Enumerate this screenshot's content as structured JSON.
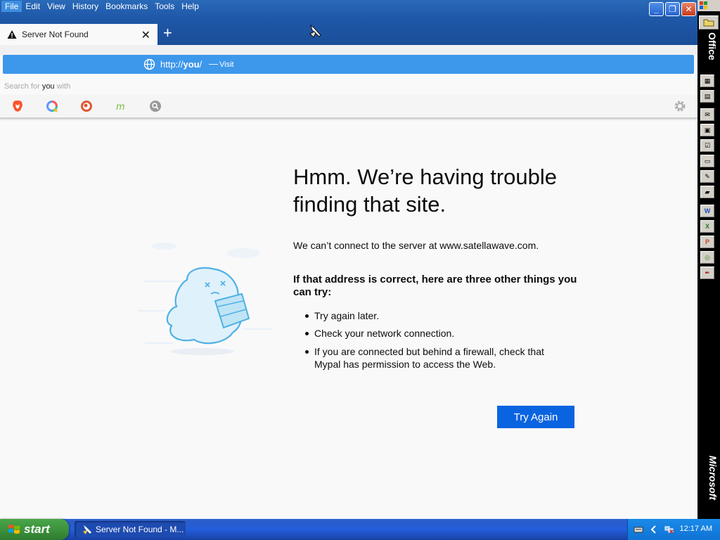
{
  "menubar": {
    "items": [
      "File",
      "Edit",
      "View",
      "History",
      "Bookmarks",
      "Tools",
      "Help"
    ]
  },
  "window_controls": {
    "minimize": "_",
    "maximize": "❐",
    "close": "✕"
  },
  "tab": {
    "title": "Server Not Found",
    "close": "✕"
  },
  "new_tab": "+",
  "urlbar_popup": {
    "url_prefix": "http://",
    "url_host": "you",
    "url_suffix": "/",
    "separator": "—",
    "action": "Visit"
  },
  "search_row": {
    "prefix": "Search for ",
    "query": "you",
    "suffix": " with"
  },
  "search_engines": [
    "brave-icon",
    "qwant-icon",
    "duckduckgo-icon",
    "mojeek-icon",
    "search-icon"
  ],
  "error_page": {
    "title": "Hmm. We’re having trouble finding that site.",
    "intro": "We can’t connect to the server at www.satellawave.com.",
    "try_heading": "If that address is correct, here are three other things you can try:",
    "tips": [
      "Try again later.",
      "Check your network connection.",
      "If you are connected but behind a firewall, check that Mypal has permission to access the Web."
    ],
    "button": "Try Again"
  },
  "office_bar": {
    "label": "Office",
    "vendor": "Microsoft"
  },
  "taskbar": {
    "start": "start",
    "item": "Server Not Found - M...",
    "clock": "12:17 AM"
  },
  "colors": {
    "titlebar": "#1f58a8",
    "urlbar_popup": "#3d97ea",
    "primary_button": "#0a64e0",
    "taskbar": "#245edb",
    "start_button": "#3c923c"
  }
}
